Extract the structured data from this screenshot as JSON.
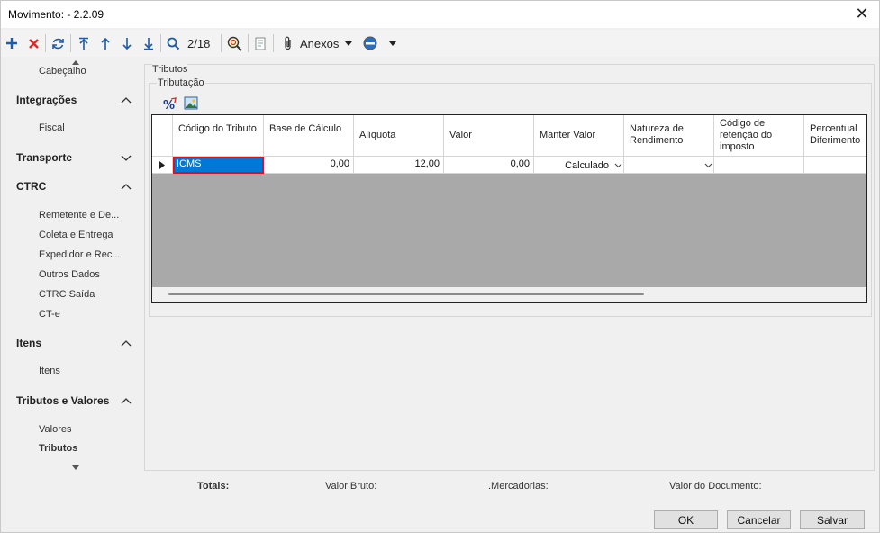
{
  "window": {
    "title": "Movimento:  - 2.2.09",
    "close_glyph": "✕"
  },
  "toolbar": {
    "pager": "2/18",
    "attachments_label": "Anexos",
    "icons": [
      "plus-icon",
      "delete-icon",
      "refresh-icon",
      "first-record-icon",
      "previous-record-icon",
      "next-record-icon",
      "last-record-icon",
      "search-icon",
      "zoom-search-icon",
      "report-icon",
      "paperclip-icon",
      "dropdown-arrow-icon",
      "view-icon",
      "dropdown-arrow-icon"
    ]
  },
  "sidebar": {
    "top_partial_item": "Cabeçalho",
    "groups": [
      {
        "title": "Integrações",
        "expanded": true,
        "items": [
          "Fiscal"
        ]
      },
      {
        "title": "Transporte",
        "expanded": false,
        "items": []
      },
      {
        "title": "CTRC",
        "expanded": true,
        "items": [
          "Remetente e De...",
          "Coleta e Entrega",
          "Expedidor e Rec...",
          "Outros Dados",
          "CTRC Saída",
          "CT-e"
        ]
      },
      {
        "title": "Itens",
        "expanded": true,
        "items": [
          "Itens"
        ]
      },
      {
        "title": "Tributos e Valores",
        "expanded": true,
        "items": [
          "Valores",
          "Tributos"
        ]
      }
    ],
    "active_item": "Tributos"
  },
  "content": {
    "group_title": "Tributos",
    "subgroup_title": "Tributação",
    "grid": {
      "columns": [
        "Código do Tributo",
        "Base de Cálculo",
        "Alíquota",
        "Valor",
        "Manter Valor",
        "Natureza de Rendimento",
        "Código de retenção do imposto",
        "Percentual Diferimento"
      ],
      "rows": [
        {
          "codigo": "ICMS",
          "base": "0,00",
          "aliquota": "12,00",
          "valor": "0,00",
          "manter": "Calculado",
          "natureza": "",
          "retencao": "",
          "percentual": ""
        }
      ]
    }
  },
  "totals": {
    "label": "Totais:",
    "valor_bruto": "Valor Bruto:",
    "mercadorias": ".Mercadorias:",
    "valor_documento": "Valor do Documento:"
  },
  "buttons": {
    "ok": "OK",
    "cancel": "Cancelar",
    "save": "Salvar"
  },
  "colors": {
    "accent": "#0078d7",
    "selection_border": "#e0101a",
    "delete_red": "#d32f2f",
    "toolbar_blue": "#1e5ba8"
  }
}
